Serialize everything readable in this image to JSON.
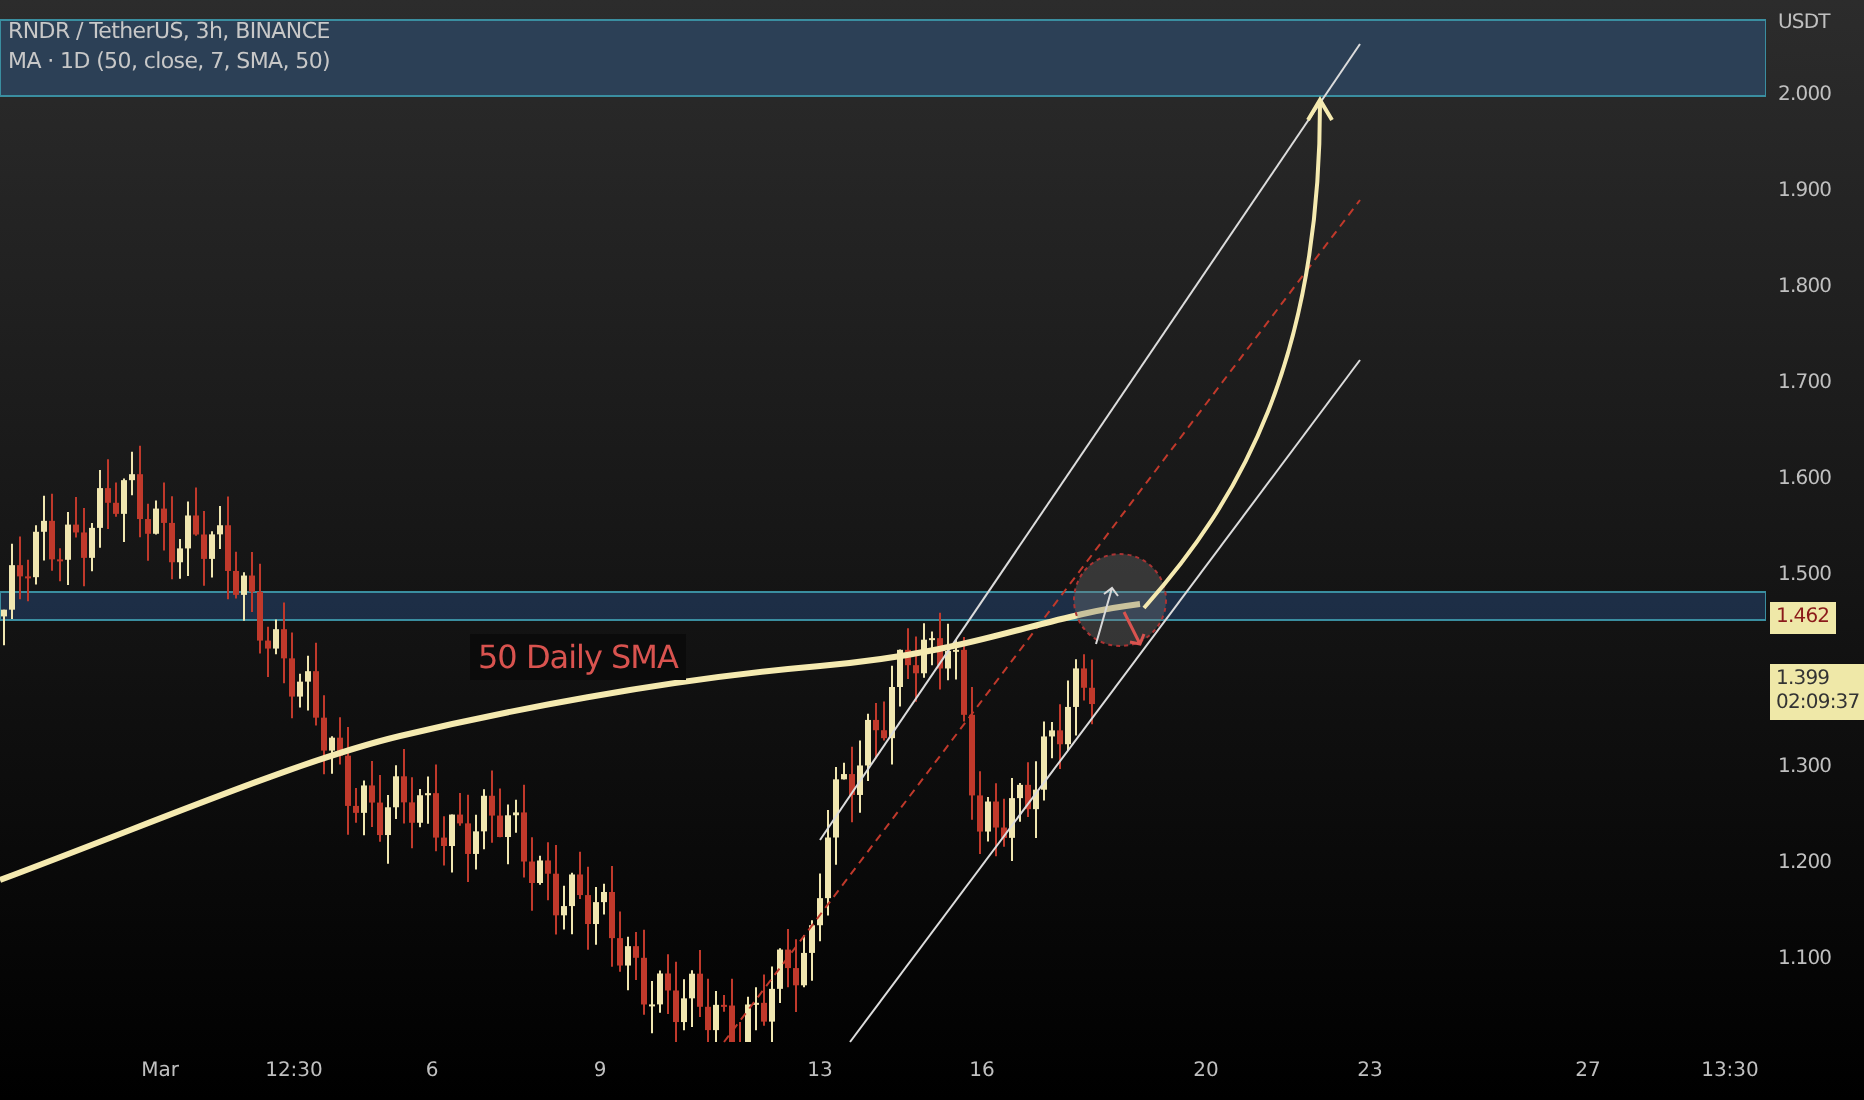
{
  "legend": {
    "symbol": "RNDR / TetherUS, 3h, BINANCE",
    "indicator": "MA · 1D (50, close, 7, SMA, 50)"
  },
  "price_axis": {
    "currency": "USDT",
    "ticks": [
      "2.000",
      "1.900",
      "1.800",
      "1.700",
      "1.600",
      "1.500",
      "1.300",
      "1.200",
      "1.100"
    ],
    "markers": [
      {
        "kind": "level",
        "price": "1.462"
      },
      {
        "kind": "last",
        "price": "1.399",
        "countdown": "02:09:37"
      }
    ]
  },
  "time_axis": {
    "ticks": [
      "Mar",
      "12:30",
      "6",
      "9",
      "13",
      "16",
      "20",
      "23",
      "27",
      "13:30"
    ]
  },
  "annotations": [
    {
      "kind": "label",
      "text": "50 Daily SMA"
    }
  ]
}
